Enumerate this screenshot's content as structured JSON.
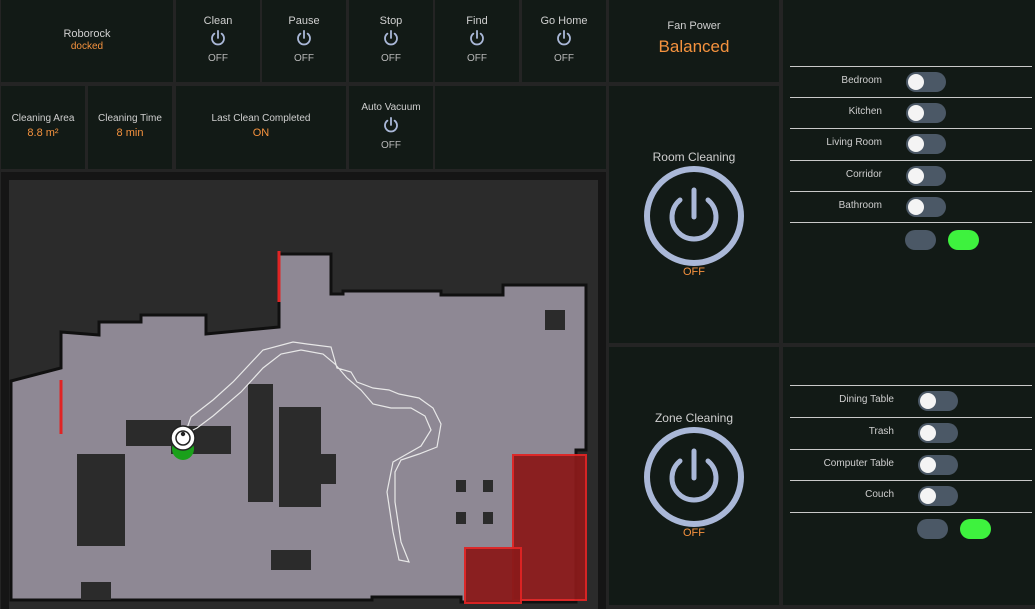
{
  "status": {
    "name": "Roborock",
    "value": "docked"
  },
  "controls": [
    {
      "label": "Clean",
      "state": "OFF",
      "icon": "power-icon"
    },
    {
      "label": "Pause",
      "state": "OFF",
      "icon": "power-icon"
    },
    {
      "label": "Stop",
      "state": "OFF",
      "icon": "power-icon"
    },
    {
      "label": "Find",
      "state": "OFF",
      "icon": "power-icon"
    },
    {
      "label": "Go Home",
      "state": "OFF",
      "icon": "power-icon"
    }
  ],
  "fan": {
    "label": "Fan Power",
    "value": "Balanced"
  },
  "stats": {
    "area_label": "Cleaning Area",
    "area_value": "8.8 m²",
    "time_label": "Cleaning Time",
    "time_value": "8 min",
    "last_label": "Last Clean Completed",
    "last_value": "ON"
  },
  "auto_vacuum": {
    "label": "Auto Vacuum",
    "state": "OFF"
  },
  "room_cleaning": {
    "title": "Room Cleaning",
    "state": "OFF"
  },
  "zone_cleaning": {
    "title": "Zone Cleaning",
    "state": "OFF"
  },
  "rooms": [
    {
      "name": "Bedroom"
    },
    {
      "name": "Kitchen"
    },
    {
      "name": "Living Room"
    },
    {
      "name": "Corridor"
    },
    {
      "name": "Bathroom"
    }
  ],
  "zones": [
    {
      "name": "Dining Table"
    },
    {
      "name": "Trash"
    },
    {
      "name": "Computer Table"
    },
    {
      "name": "Couch"
    }
  ],
  "colors": {
    "accent": "#f5923e",
    "icon": "#aab8d8",
    "toggle_off": "#4b5866",
    "confirm": "#3ef23e",
    "zone_fill": "#8a1a1a",
    "zone_border": "#e02424"
  }
}
